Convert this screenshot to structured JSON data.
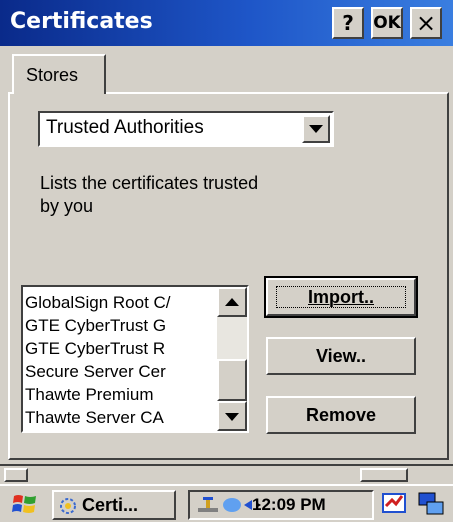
{
  "window": {
    "title": "Certificates",
    "help_label": "?",
    "ok_label": "OK",
    "close_label": "×"
  },
  "tabs": [
    {
      "label": "Stores"
    }
  ],
  "store_select": {
    "value": "Trusted Authorities"
  },
  "description": "Lists the certificates trusted by you",
  "certificates": [
    "GlobalSign Root C/",
    "GTE CyberTrust G",
    "GTE CyberTrust R",
    "Secure Server Cer",
    "Thawte Premium",
    "Thawte Server CA"
  ],
  "buttons": {
    "import": "Import..",
    "view": "View..",
    "remove": "Remove"
  },
  "taskbar": {
    "task_label": "Certi...",
    "clock": "12:09 PM"
  },
  "colors": {
    "title_bar_start": "#0a2a8a",
    "title_bar_end": "#3a7ee0",
    "face": "#d4d0c8"
  },
  "icons": [
    "start-icon",
    "certificate-app-icon",
    "network-icon",
    "connection-icon",
    "input-panel-icon",
    "desktop-switch-icon"
  ]
}
